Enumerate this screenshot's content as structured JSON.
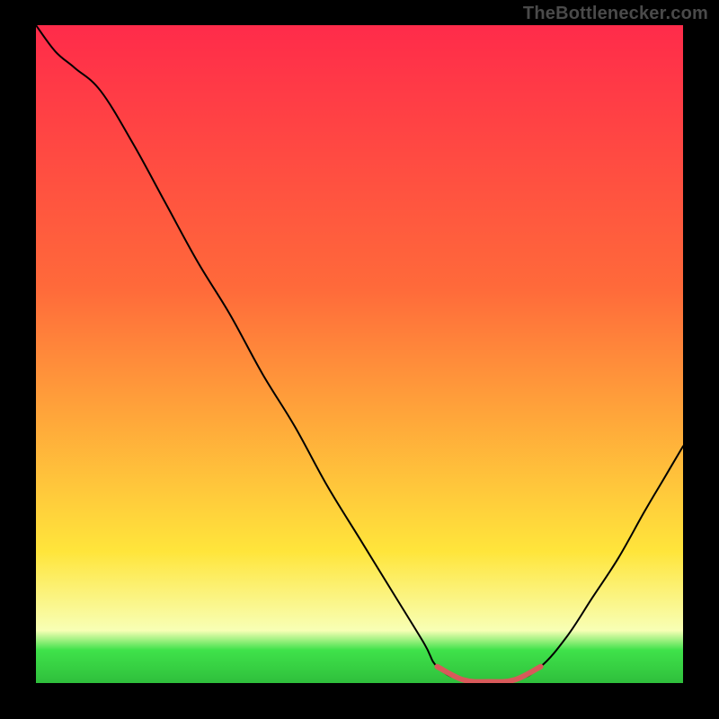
{
  "watermark": "TheBottlenecker.com",
  "colors": {
    "frame_bg": "#000000",
    "watermark_text": "#4a4a4a",
    "gradient_top": "#ff2b4a",
    "gradient_mid1": "#ff6a3a",
    "gradient_mid2": "#ffe53b",
    "gradient_band_pale": "#f8ffb5",
    "gradient_band_green": "#3fe24a",
    "curve_stroke": "#000000",
    "trough_stroke": "#d85a5a"
  },
  "chart_data": {
    "type": "line",
    "title": "",
    "xlabel": "",
    "ylabel": "",
    "xlim": [
      0,
      100
    ],
    "ylim": [
      0,
      100
    ],
    "series": [
      {
        "name": "bottleneck-curve",
        "x": [
          0,
          3,
          6,
          10,
          15,
          20,
          25,
          30,
          35,
          40,
          45,
          50,
          55,
          60,
          62,
          66,
          74,
          78,
          82,
          86,
          90,
          94,
          97,
          100
        ],
        "y": [
          100,
          96,
          93.5,
          90,
          82,
          73,
          64,
          56,
          47,
          39,
          30,
          22,
          14,
          6,
          2.5,
          0.5,
          0.5,
          2.5,
          7,
          13,
          19,
          26,
          31,
          36
        ]
      },
      {
        "name": "optimal-range",
        "x": [
          62,
          66,
          70,
          74,
          78
        ],
        "y": [
          2.5,
          0.5,
          0.2,
          0.5,
          2.5
        ]
      }
    ],
    "optimal_range_pct": [
      62,
      78
    ],
    "background_gradient": {
      "stops_pct": [
        0,
        40,
        80,
        92,
        95,
        100
      ],
      "colors": [
        "#ff2b4a",
        "#ff6a3a",
        "#ffe53b",
        "#f8ffb5",
        "#3fe24a",
        "#2fbf3c"
      ]
    }
  }
}
